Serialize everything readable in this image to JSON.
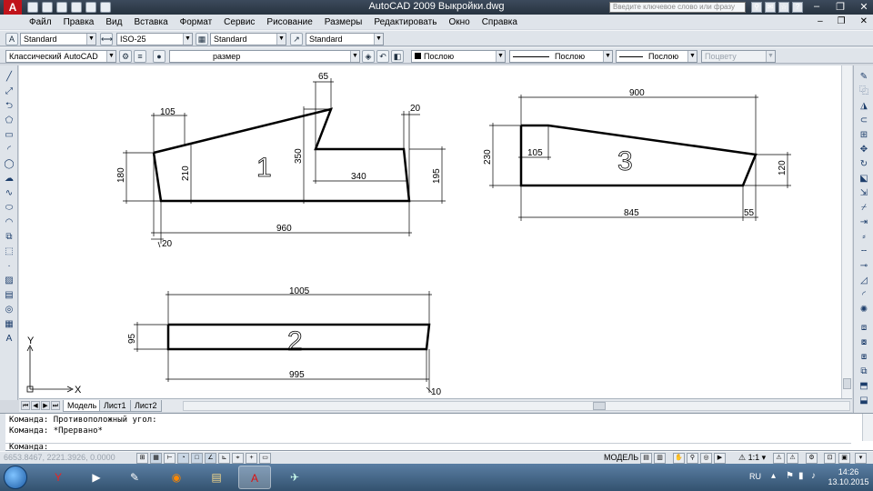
{
  "window": {
    "app_title": "AutoCAD 2009",
    "doc_title": "Выкройки.dwg",
    "search_placeholder": "Введите ключевое слово или фразу",
    "logo_letter": "A"
  },
  "menu": [
    "Файл",
    "Правка",
    "Вид",
    "Вставка",
    "Формат",
    "Сервис",
    "Рисование",
    "Размеры",
    "Редактировать",
    "Окно",
    "Справка"
  ],
  "toolbar1": {
    "text_style": "Standard",
    "dim_style": "ISO-25",
    "table_style": "Standard",
    "mleader_style": "Standard"
  },
  "toolbar2": {
    "workspace": "Классический AutoCAD",
    "layer": "размер",
    "color": "Послою",
    "linetype": "Послою",
    "lineweight": "Послою",
    "plotstyle": "Поцвету"
  },
  "drawing": {
    "shape1": {
      "number": "1",
      "dims": {
        "d65": "65",
        "d105": "105",
        "d20_top": "20",
        "d350": "350",
        "d180": "180",
        "d210": "210",
        "d340": "340",
        "d195": "195",
        "d960": "960",
        "d20_bottom": "20"
      }
    },
    "shape2": {
      "number": "2",
      "dims": {
        "d1005": "1005",
        "d95": "95",
        "d995": "995",
        "d10": "10"
      }
    },
    "shape3": {
      "number": "3",
      "dims": {
        "d900": "900",
        "d230": "230",
        "d105": "105",
        "d120": "120",
        "d845": "845",
        "d55": "55"
      }
    },
    "ucs": {
      "x": "X",
      "y": "Y"
    }
  },
  "tabs": [
    "Модель",
    "Лист1",
    "Лист2"
  ],
  "command": {
    "line1": "Команда: Противоположный угол:",
    "line2": "Команда: *Прервано*",
    "prompt": "Команда:"
  },
  "status": {
    "coords": "6653.8467, 2221.3926, 0.0000",
    "model_label": "МОДЕЛЬ",
    "scale": "1:1"
  },
  "taskbar": {
    "lang": "RU",
    "time": "14:26",
    "date": "13.10.2015"
  }
}
